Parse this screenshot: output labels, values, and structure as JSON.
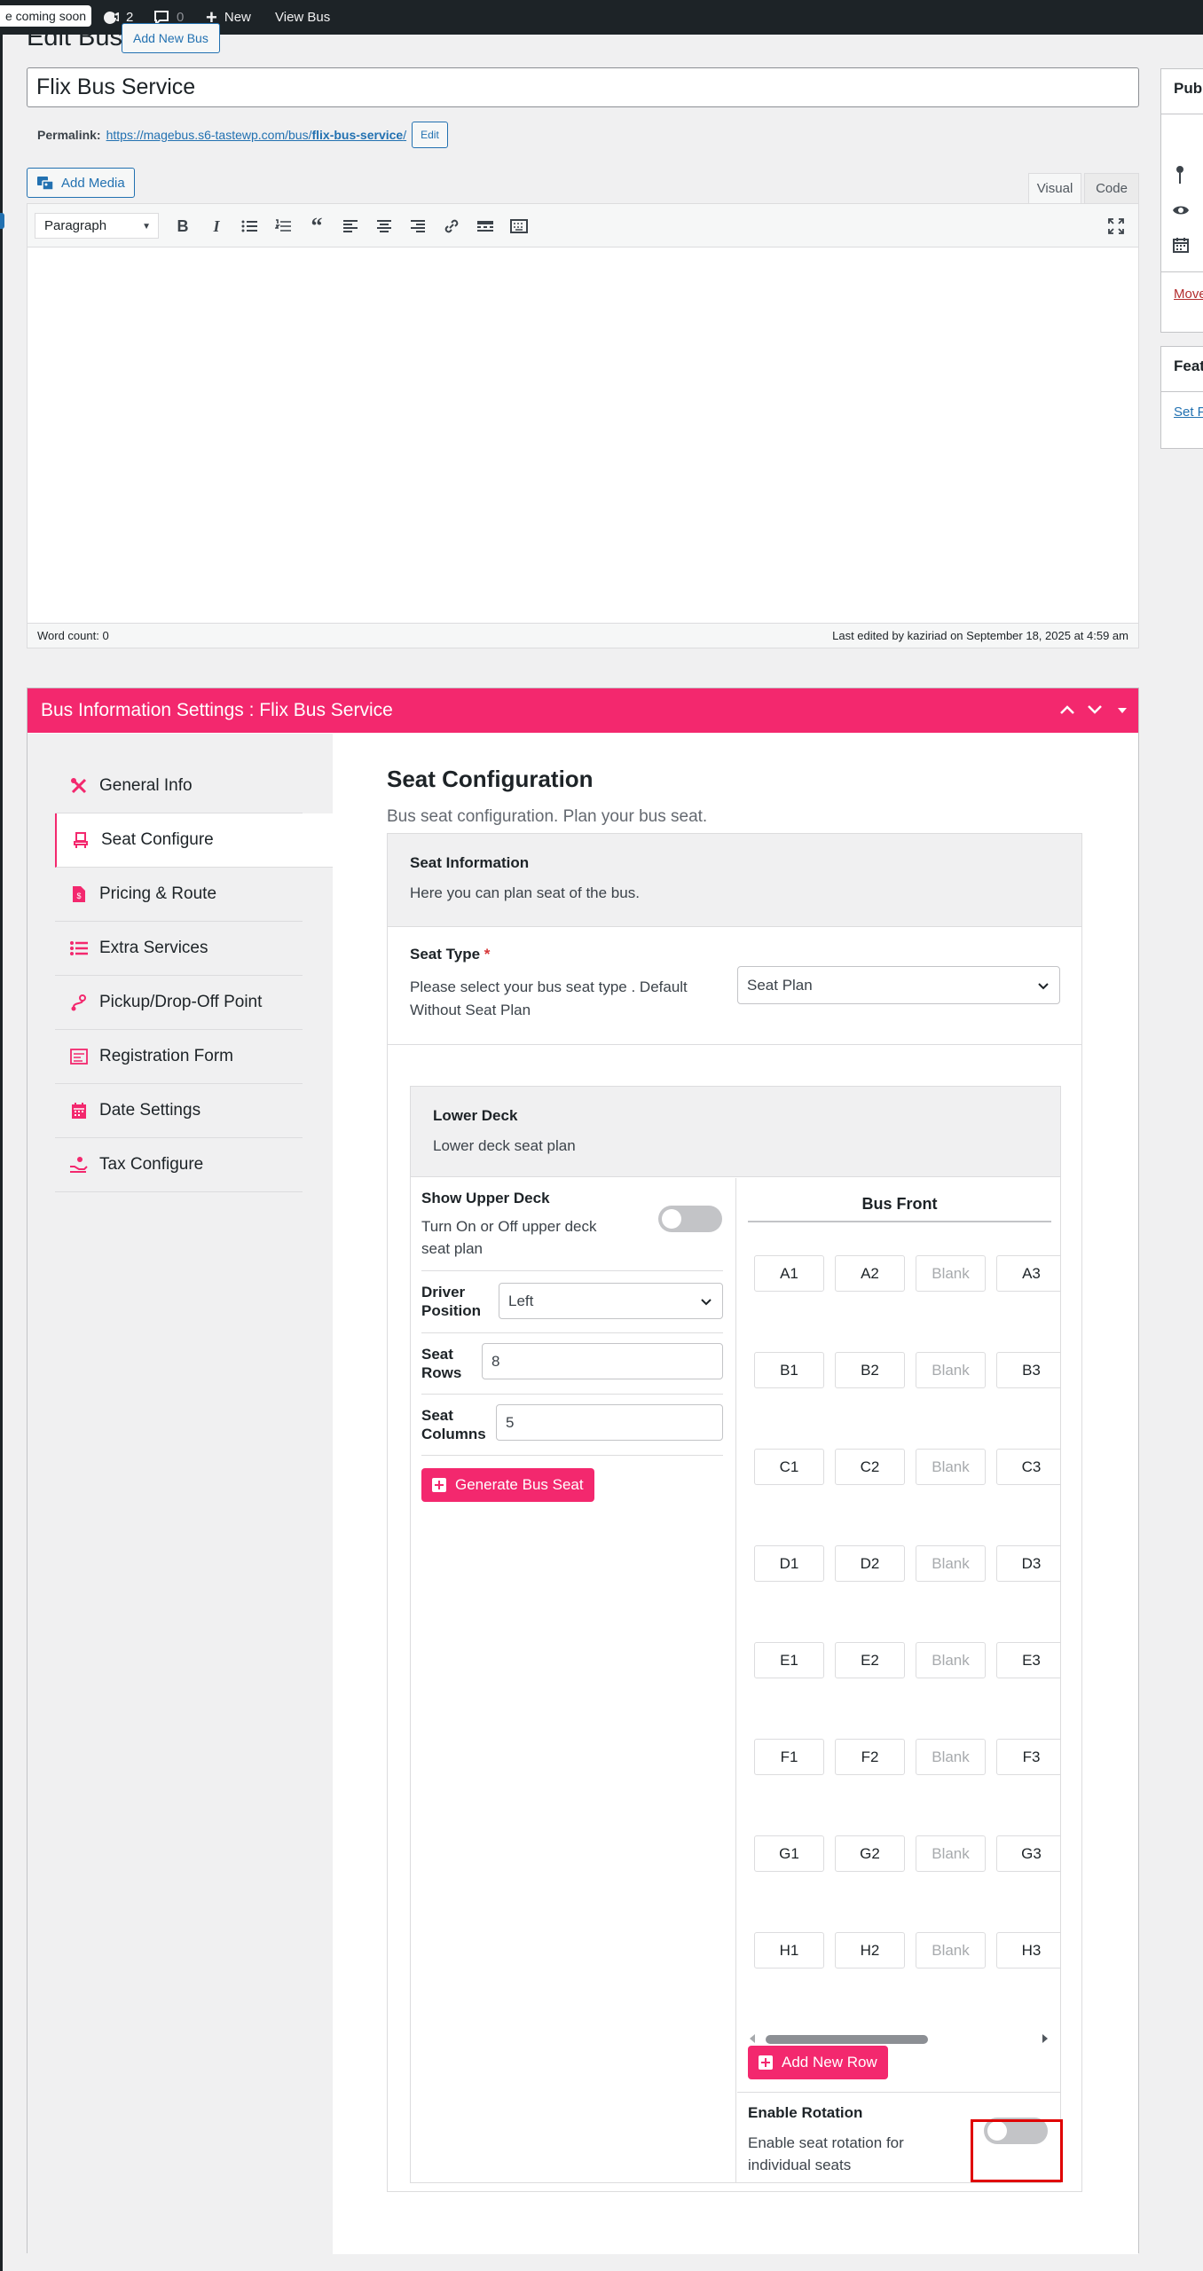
{
  "adminbar": {
    "site_pill": "e coming soon",
    "updates_count": "2",
    "comments_count": "0",
    "new_label": "New",
    "view_label": "View Bus"
  },
  "heading": {
    "title": "Edit Bus",
    "add_new": "Add New Bus"
  },
  "post": {
    "title": "Flix Bus Service",
    "permalink_label": "Permalink:",
    "permalink_base": "https://magebus.s6-tastewp.com/bus/",
    "permalink_slug": "flix-bus-service",
    "permalink_tail": "/",
    "permalink_edit": "Edit"
  },
  "editor": {
    "add_media": "Add Media",
    "tab_visual": "Visual",
    "tab_code": "Code",
    "format": "Paragraph",
    "word_count": "Word count: 0",
    "last_edited": "Last edited by kaziriad on September 18, 2025 at 4:59 am"
  },
  "sidebar": {
    "publish_title": "Publ",
    "feature_title": "Feat",
    "move_link": "Move",
    "set_link": "Set F"
  },
  "metabox": {
    "title": "Bus Information Settings : Flix Bus Service",
    "nav": [
      {
        "label": "General Info",
        "icon": "tools-icon"
      },
      {
        "label": "Seat Configure",
        "icon": "seat-icon"
      },
      {
        "label": "Pricing & Route",
        "icon": "file-dollar-icon"
      },
      {
        "label": "Extra Services",
        "icon": "list-icon"
      },
      {
        "label": "Pickup/Drop-Off Point",
        "icon": "route-icon"
      },
      {
        "label": "Registration Form",
        "icon": "form-icon"
      },
      {
        "label": "Date Settings",
        "icon": "calendar-icon"
      },
      {
        "label": "Tax Configure",
        "icon": "hand-coin-icon"
      }
    ]
  },
  "seat_config": {
    "title": "Seat Configuration",
    "subtitle": "Bus seat configuration. Plan your bus seat.",
    "info_title": "Seat Information",
    "info_desc": "Here you can plan seat of the bus.",
    "seat_type_label": "Seat Type",
    "required_mark": "*",
    "seat_type_desc": "Please select your bus seat type . Default Without Seat Plan",
    "seat_type_value": "Seat Plan",
    "deck_title": "Lower Deck",
    "deck_desc": "Lower deck seat plan",
    "upper_deck_label": "Show Upper Deck",
    "upper_deck_desc": "Turn On or Off upper deck seat plan",
    "upper_deck_on": false,
    "driver_label": "Driver Position",
    "driver_value": "Left",
    "rows_label": "Seat Rows",
    "rows_value": "8",
    "cols_label": "Seat Columns",
    "cols_value": "5",
    "generate_btn": "Generate Bus Seat",
    "bus_front": "Bus Front",
    "seat_rows": [
      [
        "A1",
        "A2",
        "Blank",
        "A3"
      ],
      [
        "B1",
        "B2",
        "Blank",
        "B3"
      ],
      [
        "C1",
        "C2",
        "Blank",
        "C3"
      ],
      [
        "D1",
        "D2",
        "Blank",
        "D3"
      ],
      [
        "E1",
        "E2",
        "Blank",
        "E3"
      ],
      [
        "F1",
        "F2",
        "Blank",
        "F3"
      ],
      [
        "G1",
        "G2",
        "Blank",
        "G3"
      ],
      [
        "H1",
        "H2",
        "Blank",
        "H3"
      ]
    ],
    "add_row_btn": "Add New Row",
    "rotation_label": "Enable Rotation",
    "rotation_desc": "Enable seat rotation for individual seats",
    "rotation_on": false
  },
  "colors": {
    "accent": "#f3286e",
    "link": "#2271b1",
    "highlight": "#e00000"
  }
}
